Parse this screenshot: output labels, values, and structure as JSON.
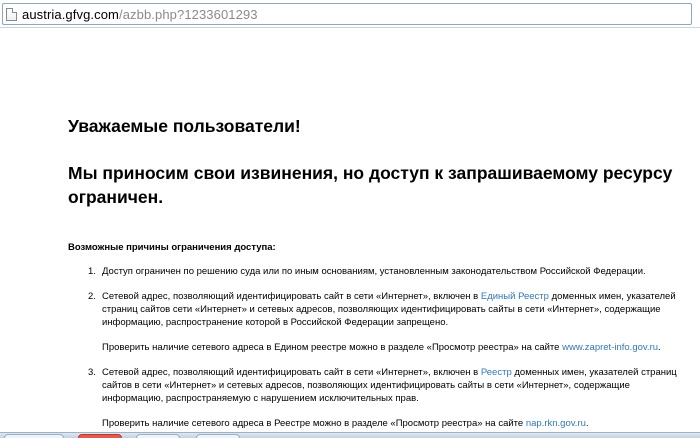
{
  "address_bar": {
    "url_host": "austria.gfvg.com",
    "url_path": "/azbb.php?1233601293"
  },
  "page": {
    "greeting": "Уважаемые пользователи!",
    "apology": "Мы приносим свои извинения, но доступ к запрашиваемому ресурсу ограничен.",
    "reasons_title": "Возможные причины ограничения доступа:",
    "reasons": [
      {
        "num": "1.",
        "text": "Доступ ограничен  по решению суда или по иным основаниям, установленным законодательством Российской Федерации."
      },
      {
        "num": "2.",
        "text_before": "Сетевой адрес, позволяющий идентифицировать сайт в сети «Интернет», включен в ",
        "link": "Единый Реестр",
        "text_after": " доменных имен, указателей страниц сайтов сети «Интернет» и сетевых адресов, позволяющих идентифицировать сайты в сети «Интернет», содержащие информацию, распространение которой в Российской Федерации запрещено.",
        "check_before": "Проверить наличие сетевого адреса в Едином реестре можно в разделе «Просмотр реестра» на сайте ",
        "check_link": "www.zapret-info.gov.ru",
        "check_after": "."
      },
      {
        "num": "3.",
        "text_before": "Сетевой адрес, позволяющий идентифицировать сайт в сети «Интернет», включен в ",
        "link": "Реестр",
        "text_after": " доменных имен, указателей страниц сайтов в сети «Интернет» и сетевых адресов, позволяющих идентифицировать сайты в сети «Интернет», содержащие информацию, распространяемую с нарушением исключительных прав.",
        "check_before": "Проверить наличие сетевого адреса в Реестре можно в разделе «Просмотр реестра» на сайте ",
        "check_link": "nap.rkn.gov.ru",
        "check_after": "."
      }
    ]
  },
  "colors": {
    "link": "#3478b5",
    "url_path": "#8a8a8a"
  }
}
